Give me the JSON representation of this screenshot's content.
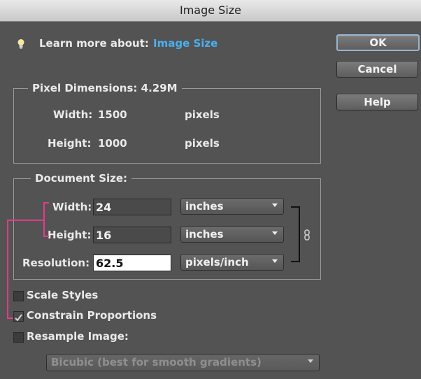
{
  "window": {
    "title": "Image Size"
  },
  "learn": {
    "prefix": "Learn more about:",
    "link": "Image Size"
  },
  "buttons": {
    "ok": "OK",
    "cancel": "Cancel",
    "help": "Help"
  },
  "pixel_dimensions": {
    "legend": "Pixel Dimensions:",
    "size": "4.29M",
    "width_label": "Width:",
    "width_value": "1500",
    "width_unit": "pixels",
    "height_label": "Height:",
    "height_value": "1000",
    "height_unit": "pixels"
  },
  "document_size": {
    "legend": "Document Size:",
    "width_label": "Width:",
    "width_value": "24",
    "width_unit": "inches",
    "height_label": "Height:",
    "height_value": "16",
    "height_unit": "inches",
    "resolution_label": "Resolution:",
    "resolution_value": "62.5",
    "resolution_unit": "pixels/inch"
  },
  "options": {
    "scale_styles": {
      "label": "Scale Styles",
      "checked": false
    },
    "constrain": {
      "label": "Constrain Proportions",
      "checked": true
    },
    "resample": {
      "label": "Resample Image:",
      "checked": false
    },
    "resample_method": "Bicubic (best for smooth gradients)"
  },
  "colors": {
    "panel": "#535353",
    "link": "#49b0ee",
    "annotation": "#e03c8c"
  },
  "icons": [
    "lightbulb-icon",
    "chain-link-icon",
    "checkmark-icon",
    "chevron-down-icon"
  ]
}
